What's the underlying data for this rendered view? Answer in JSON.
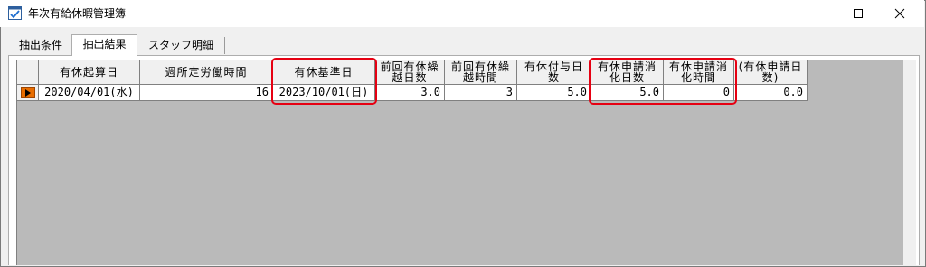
{
  "window": {
    "title": "年次有給休暇管理簿",
    "controls": {
      "minimize": "minimize-icon",
      "maximize": "maximize-icon",
      "close": "close-icon"
    }
  },
  "tabs": [
    {
      "label": "抽出条件",
      "active": false
    },
    {
      "label": "抽出結果",
      "active": true
    },
    {
      "label": "スタッフ明細",
      "active": false
    }
  ],
  "grid": {
    "columns": [
      "有休起算日",
      "週所定労働時間",
      "有休基準日",
      "前回有休繰越日数",
      "前回有休繰越時間",
      "有休付与日数",
      "有休申請消化日数",
      "有休申請消化時間",
      "(有休申請日数)"
    ],
    "rows": [
      {
        "current_row_icon": "play-arrow-icon",
        "cells": [
          "2020/04/01(水)",
          "16",
          "2023/10/01(日)",
          "3.0",
          "3",
          "5.0",
          "5.0",
          "0",
          "0.0"
        ]
      }
    ],
    "highlight_color": "#e60012",
    "row_indicator_color": "#e86d00",
    "background_color": "#bababa"
  }
}
